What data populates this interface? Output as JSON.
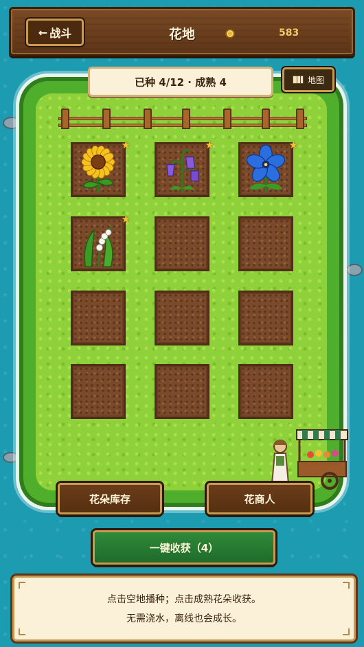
{
  "header": {
    "back_label": "战斗",
    "back_arrow": "←",
    "title": "花地",
    "coin_icon": "coin-icon",
    "coins": "583"
  },
  "status": {
    "text": "已种 4/12 · 成熟 4"
  },
  "map_button": {
    "label": "地图",
    "icon": "map-icon"
  },
  "plots": [
    {
      "flower": "sunflower",
      "mature": true
    },
    {
      "flower": "bellflower",
      "mature": true
    },
    {
      "flower": "blue-star-flower",
      "mature": true
    },
    {
      "flower": "lily-of-the-valley",
      "mature": true
    },
    {
      "flower": null,
      "mature": false
    },
    {
      "flower": null,
      "mature": false
    },
    {
      "flower": null,
      "mature": false
    },
    {
      "flower": null,
      "mature": false
    },
    {
      "flower": null,
      "mature": false
    },
    {
      "flower": null,
      "mature": false
    },
    {
      "flower": null,
      "mature": false
    },
    {
      "flower": null,
      "mature": false
    }
  ],
  "mature_star": "★",
  "buttons": {
    "inventory": "花朵库存",
    "merchant": "花商人",
    "harvest_all": "一键收获（4）"
  },
  "hint": {
    "line1": "点击空地播种；点击成熟花朵收获。",
    "line2": "无需浇水，离线也会成长。"
  },
  "colors": {
    "sea": "#1d9bb0",
    "grass": "#8fd13a",
    "soil": "#7a4a2a",
    "wood": "#5d3518",
    "accent_gold": "#f5c233",
    "harvest_green": "#2e8a3a"
  }
}
